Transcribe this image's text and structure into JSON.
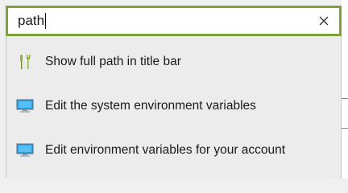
{
  "search": {
    "value": "path",
    "clear_icon": "close-icon"
  },
  "results": [
    {
      "label": "Show full path in title bar",
      "icon": "settings-tools-icon"
    },
    {
      "label": "Edit the system environment variables",
      "icon": "monitor-icon"
    },
    {
      "label": "Edit environment variables for your account",
      "icon": "monitor-icon"
    }
  ],
  "colors": {
    "accent_border": "#7ea13a",
    "dropdown_bg": "#ececec",
    "text": "#1a1a1a"
  }
}
